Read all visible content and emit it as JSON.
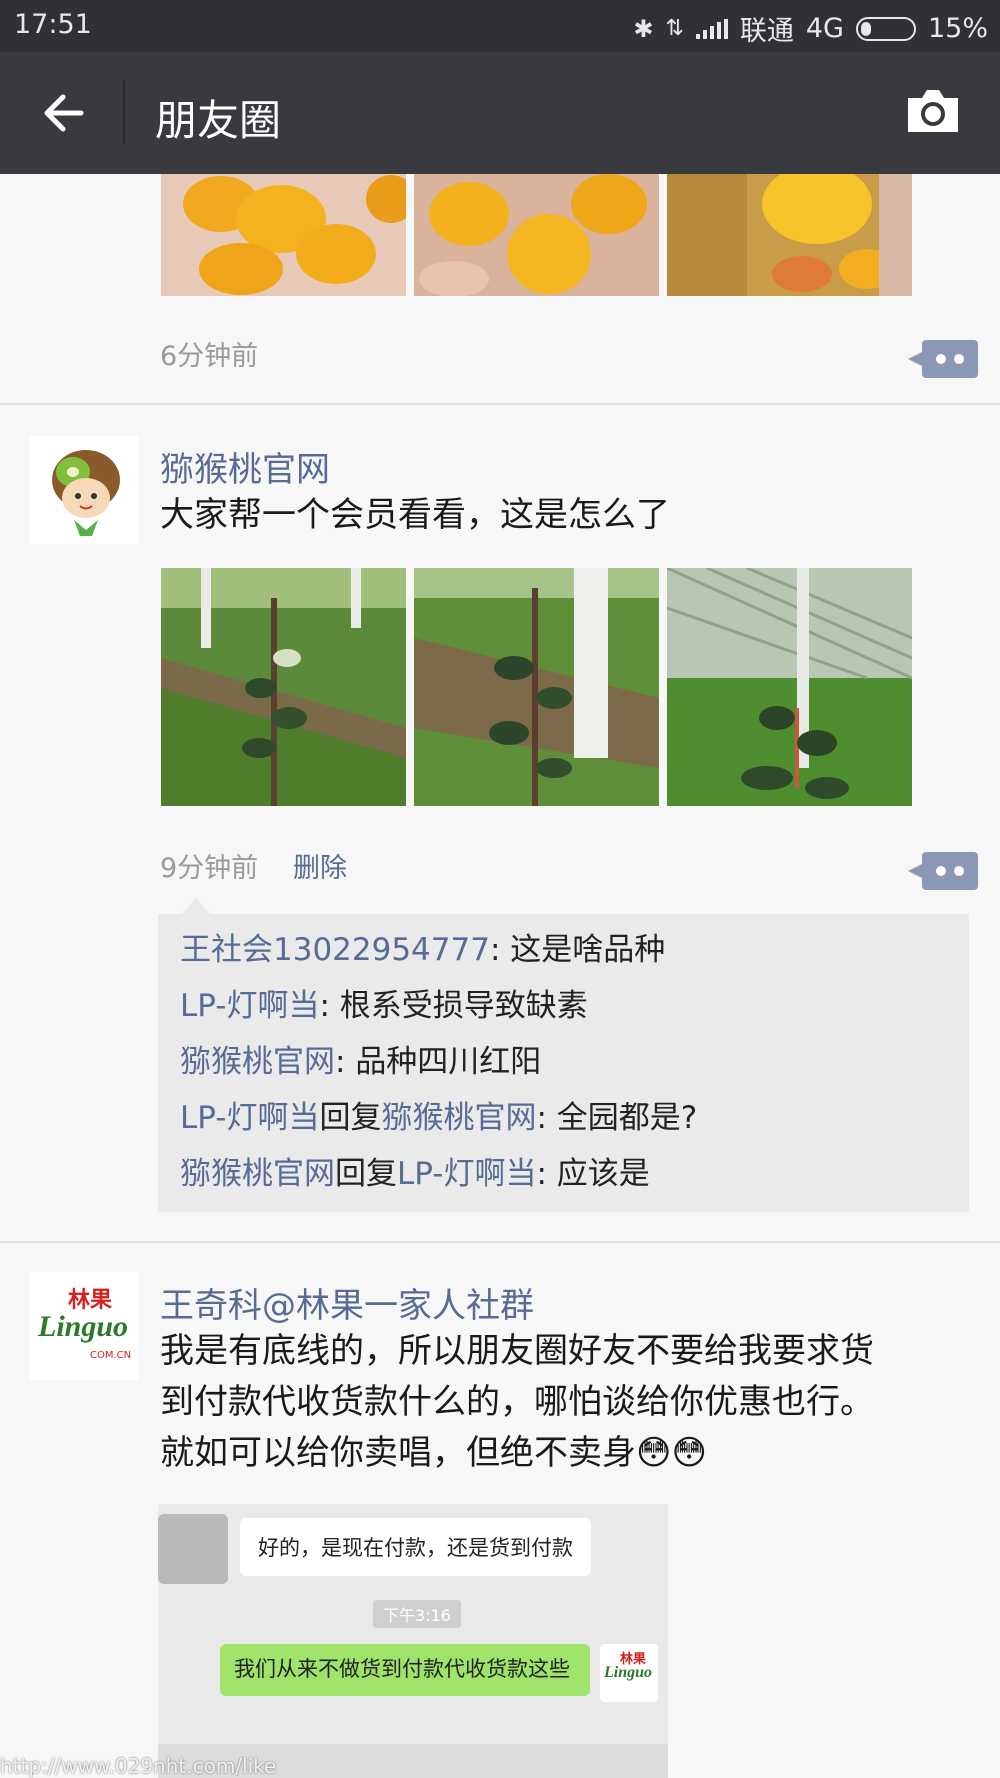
{
  "status": {
    "time": "17:51",
    "carrier": "联通",
    "network": "4G",
    "battery": "15%"
  },
  "header": {
    "title": "朋友圈"
  },
  "posts": [
    {
      "time": "6分钟前"
    },
    {
      "author": "猕猴桃官网",
      "text": "大家帮一个会员看看，这是怎么了",
      "time": "9分钟前",
      "delete_label": "删除",
      "comments": [
        {
          "from": "王社会13022954777",
          "sep": ": ",
          "text": "这是啥品种"
        },
        {
          "from": "LP-灯啊当",
          "sep": ": ",
          "text": "根系受损导致缺素"
        },
        {
          "from": "猕猴桃官网",
          "sep": ": ",
          "text": "品种四川红阳"
        },
        {
          "from": "LP-灯啊当",
          "reply_word": "回复",
          "to": "猕猴桃官网",
          "sep": ": ",
          "text": "全园都是?"
        },
        {
          "from": "猕猴桃官网",
          "reply_word": "回复",
          "to": "LP-灯啊当",
          "sep": ": ",
          "text": "应该是"
        }
      ]
    },
    {
      "author": "王奇科@林果一家人社群",
      "text_lines": [
        "我是有底线的，所以朋友圈好友不要给我要求货",
        "到付款代收货款什么的，哪怕谈给你优惠也行。",
        "就如可以给你卖唱，但绝不卖身"
      ],
      "emoji": "😳😳",
      "avatar_logo_cn": "林果",
      "avatar_logo_en": "Linguo",
      "avatar_logo_sub": "COM.CN",
      "chat": {
        "msg1": "好的，是现在付款，还是货到付款",
        "stamp": "下午3:16",
        "msg2": "我们从来不做货到付款代收货款这些"
      }
    }
  ],
  "watermark": "http://www.029nht.com/like"
}
